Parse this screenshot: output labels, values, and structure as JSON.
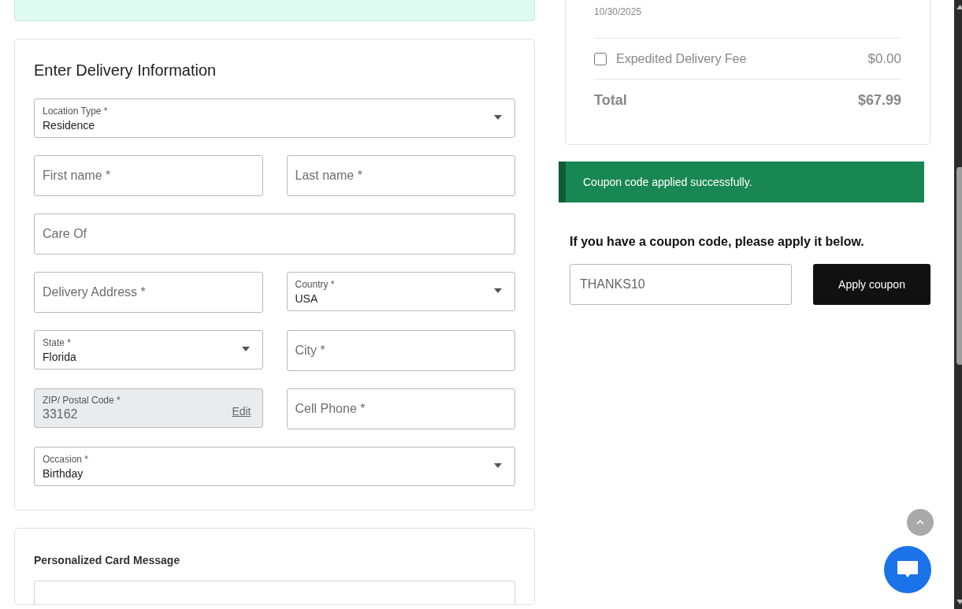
{
  "summary": {
    "delivery_date": "10/30/2025",
    "expedited": {
      "label": "Expedited Delivery Fee",
      "checked": false,
      "amount": "$0.00"
    },
    "total": {
      "label": "Total",
      "amount": "$67.99"
    }
  },
  "alert": {
    "message": "Coupon code applied successfully."
  },
  "coupon": {
    "prompt": "If you have a coupon code, please apply it below.",
    "value": "THANKS10",
    "button": "Apply coupon"
  },
  "delivery_form": {
    "title": "Enter Delivery Information",
    "rows": [
      [
        {
          "kind": "select",
          "label": "Location Type *",
          "value": "Residence"
        }
      ],
      [
        {
          "kind": "text",
          "placeholder": "First name *"
        },
        {
          "kind": "text",
          "placeholder": "Last name *"
        }
      ],
      [
        {
          "kind": "text",
          "placeholder": "Care Of"
        }
      ],
      [
        {
          "kind": "text",
          "placeholder": "Delivery Address *"
        },
        {
          "kind": "select",
          "label": "Country *",
          "value": "USA"
        }
      ],
      [
        {
          "kind": "select",
          "label": "State *",
          "value": "Florida"
        },
        {
          "kind": "text",
          "placeholder": "City *"
        }
      ],
      [
        {
          "kind": "locked",
          "label": "ZIP/ Postal Code *",
          "value": "33162",
          "action": "Edit"
        },
        {
          "kind": "text",
          "placeholder": "Cell Phone *"
        }
      ],
      [
        {
          "kind": "select",
          "label": "Occasion *",
          "value": "Birthday"
        }
      ]
    ]
  },
  "card_message": {
    "title": "Personalized Card Message"
  }
}
